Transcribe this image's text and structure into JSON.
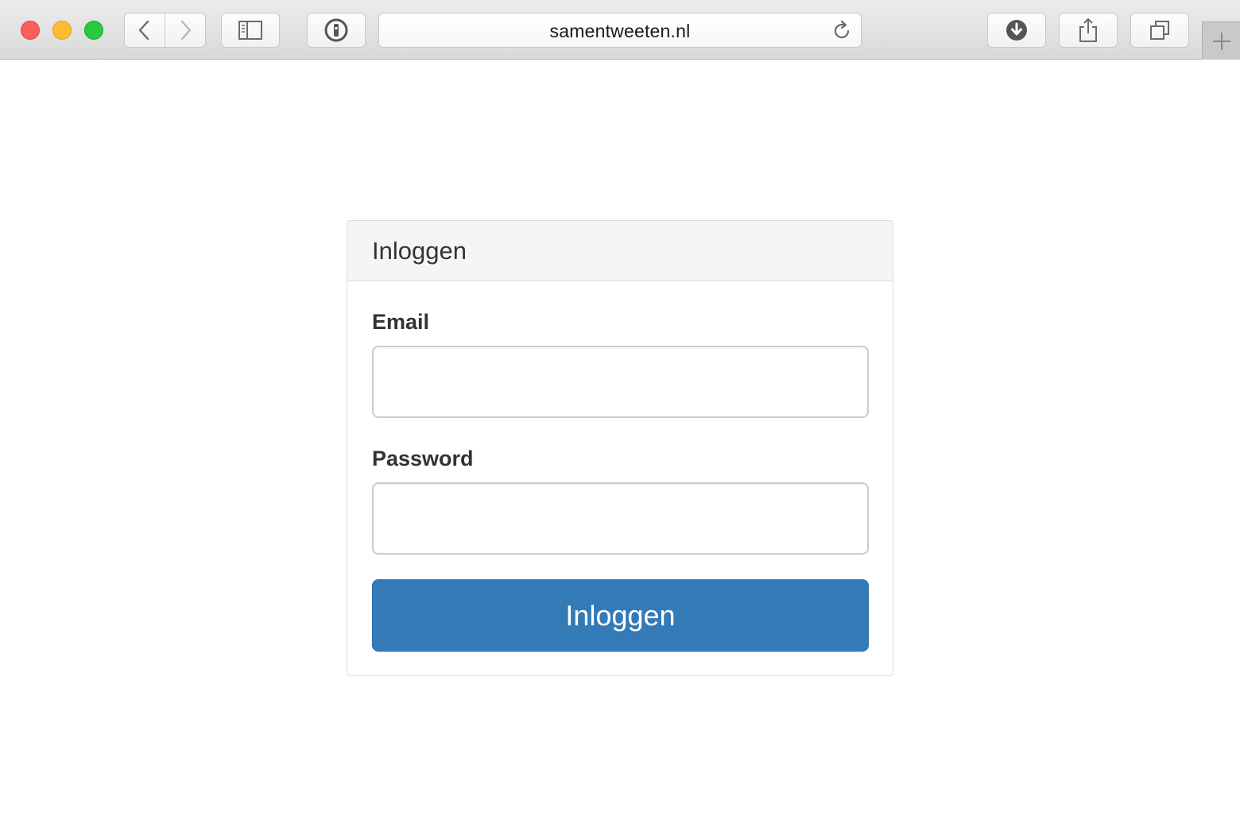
{
  "browser": {
    "url": "samentweeten.nl",
    "icons": {
      "close": "close-traffic-light",
      "minimize": "minimize-traffic-light",
      "maximize": "maximize-traffic-light",
      "back": "chevron-left-icon",
      "forward": "chevron-right-icon",
      "sidebar": "sidebar-icon",
      "password": "password-manager-icon",
      "reload": "reload-icon",
      "download": "download-icon",
      "share": "share-icon",
      "tabs": "tabs-icon",
      "new_tab": "plus-icon"
    },
    "colors": {
      "close": "#fc5f57",
      "minimize": "#fdbc2e",
      "maximize": "#28c840"
    }
  },
  "login": {
    "heading": "Inloggen",
    "email_label": "Email",
    "email_value": "",
    "password_label": "Password",
    "password_value": "",
    "submit_label": "Inloggen",
    "colors": {
      "primary": "#337ab7"
    }
  }
}
